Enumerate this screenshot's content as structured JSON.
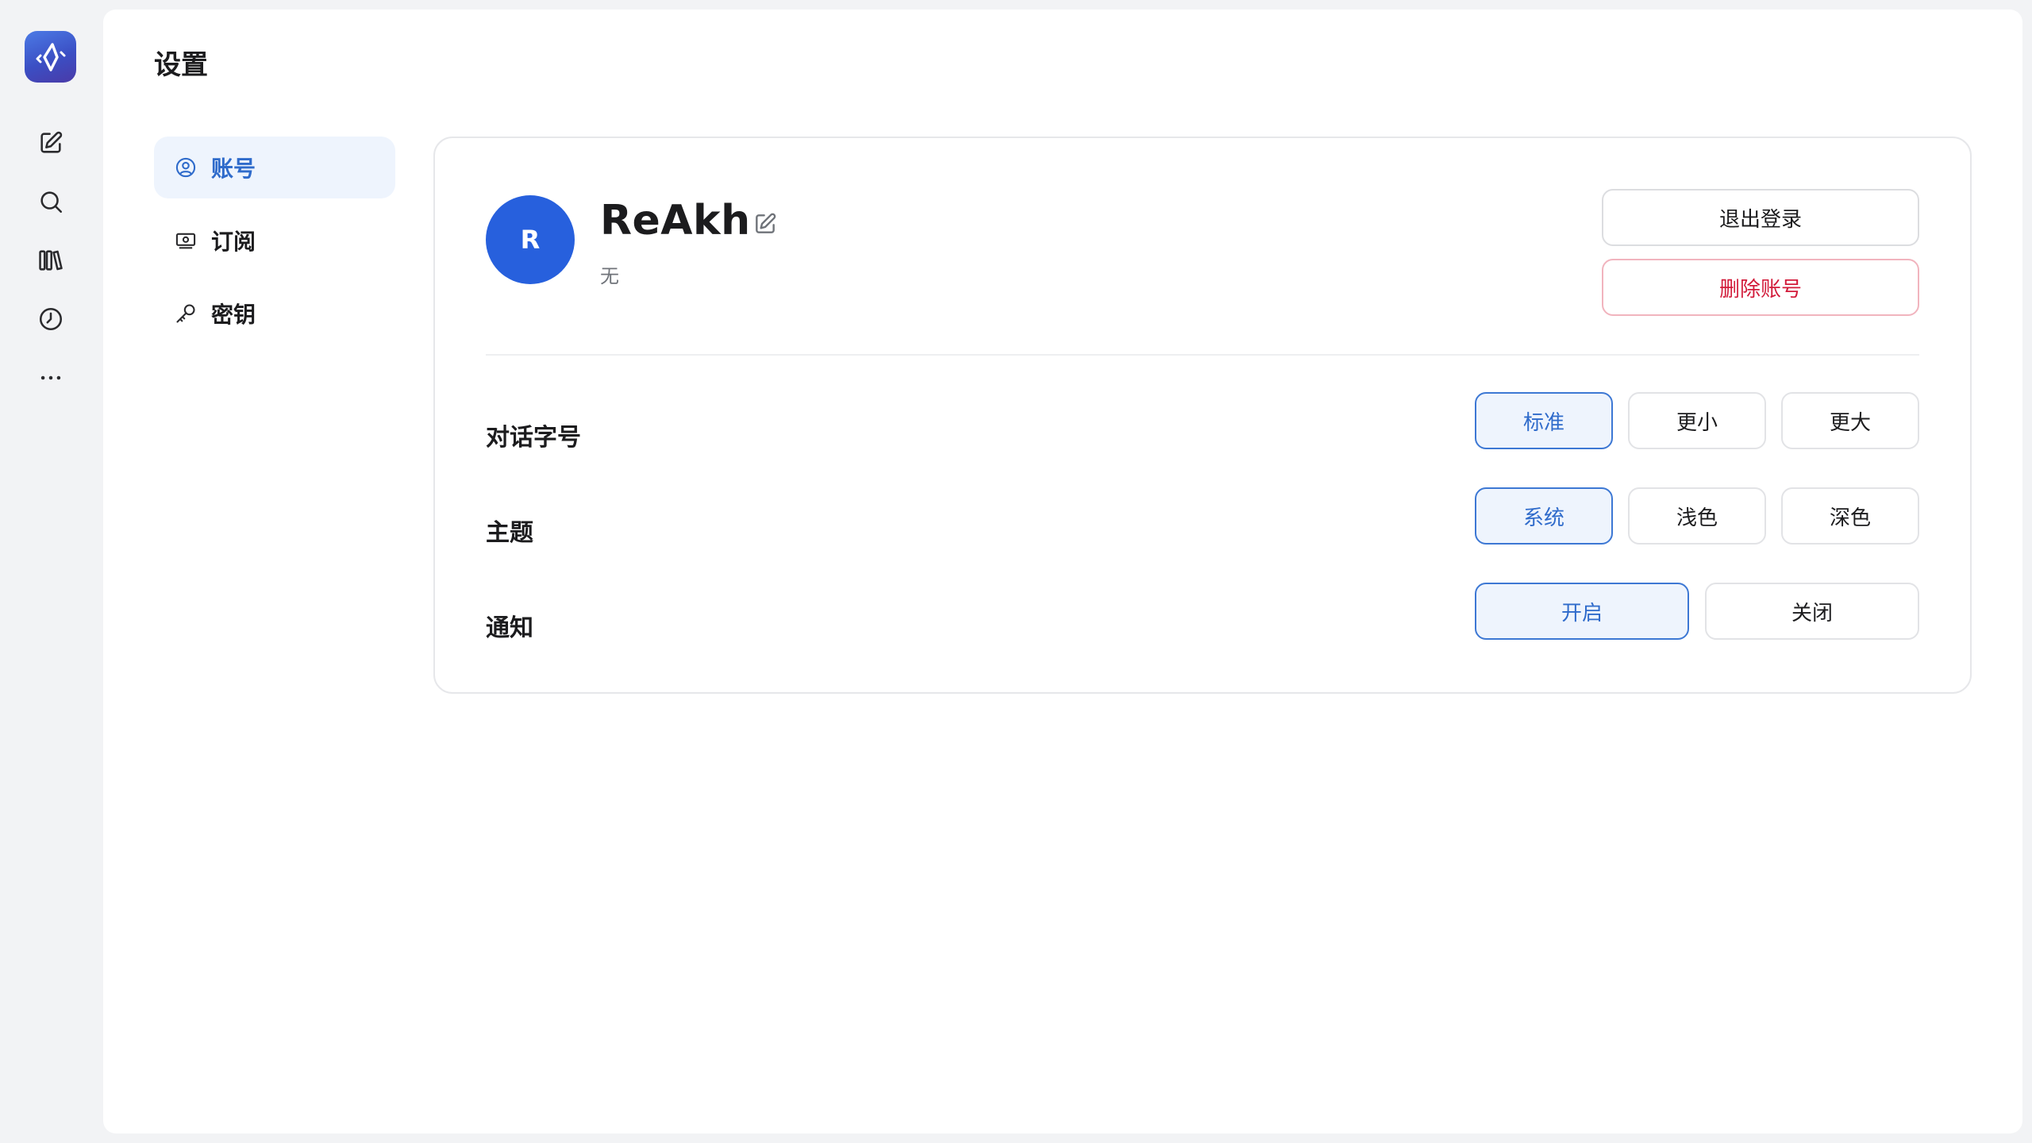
{
  "app": {
    "brand_color": "#3b4fc4",
    "accent_color": "#2f6bcb",
    "danger_color": "#d21b3a"
  },
  "rail": {
    "items": [
      {
        "icon": "compose-icon"
      },
      {
        "icon": "search-icon"
      },
      {
        "icon": "library-icon"
      },
      {
        "icon": "history-icon"
      },
      {
        "icon": "more-icon"
      }
    ]
  },
  "page": {
    "title": "设置"
  },
  "settings_nav": {
    "items": [
      {
        "label": "账号",
        "icon": "user-circle-icon",
        "active": true
      },
      {
        "label": "订阅",
        "icon": "subscription-icon",
        "active": false
      },
      {
        "label": "密钥",
        "icon": "key-icon",
        "active": false
      }
    ]
  },
  "account": {
    "avatar_initial": "R",
    "avatar_color": "#2760dd",
    "username": "ReAkh",
    "subtitle": "无",
    "logout_label": "退出登录",
    "delete_label": "删除账号"
  },
  "preferences": {
    "font_size": {
      "label": "对话字号",
      "options": [
        "标准",
        "更小",
        "更大"
      ],
      "selected": "标准"
    },
    "theme": {
      "label": "主题",
      "options": [
        "系统",
        "浅色",
        "深色"
      ],
      "selected": "系统"
    },
    "notifications": {
      "label": "通知",
      "options": [
        "开启",
        "关闭"
      ],
      "selected": "开启"
    }
  }
}
